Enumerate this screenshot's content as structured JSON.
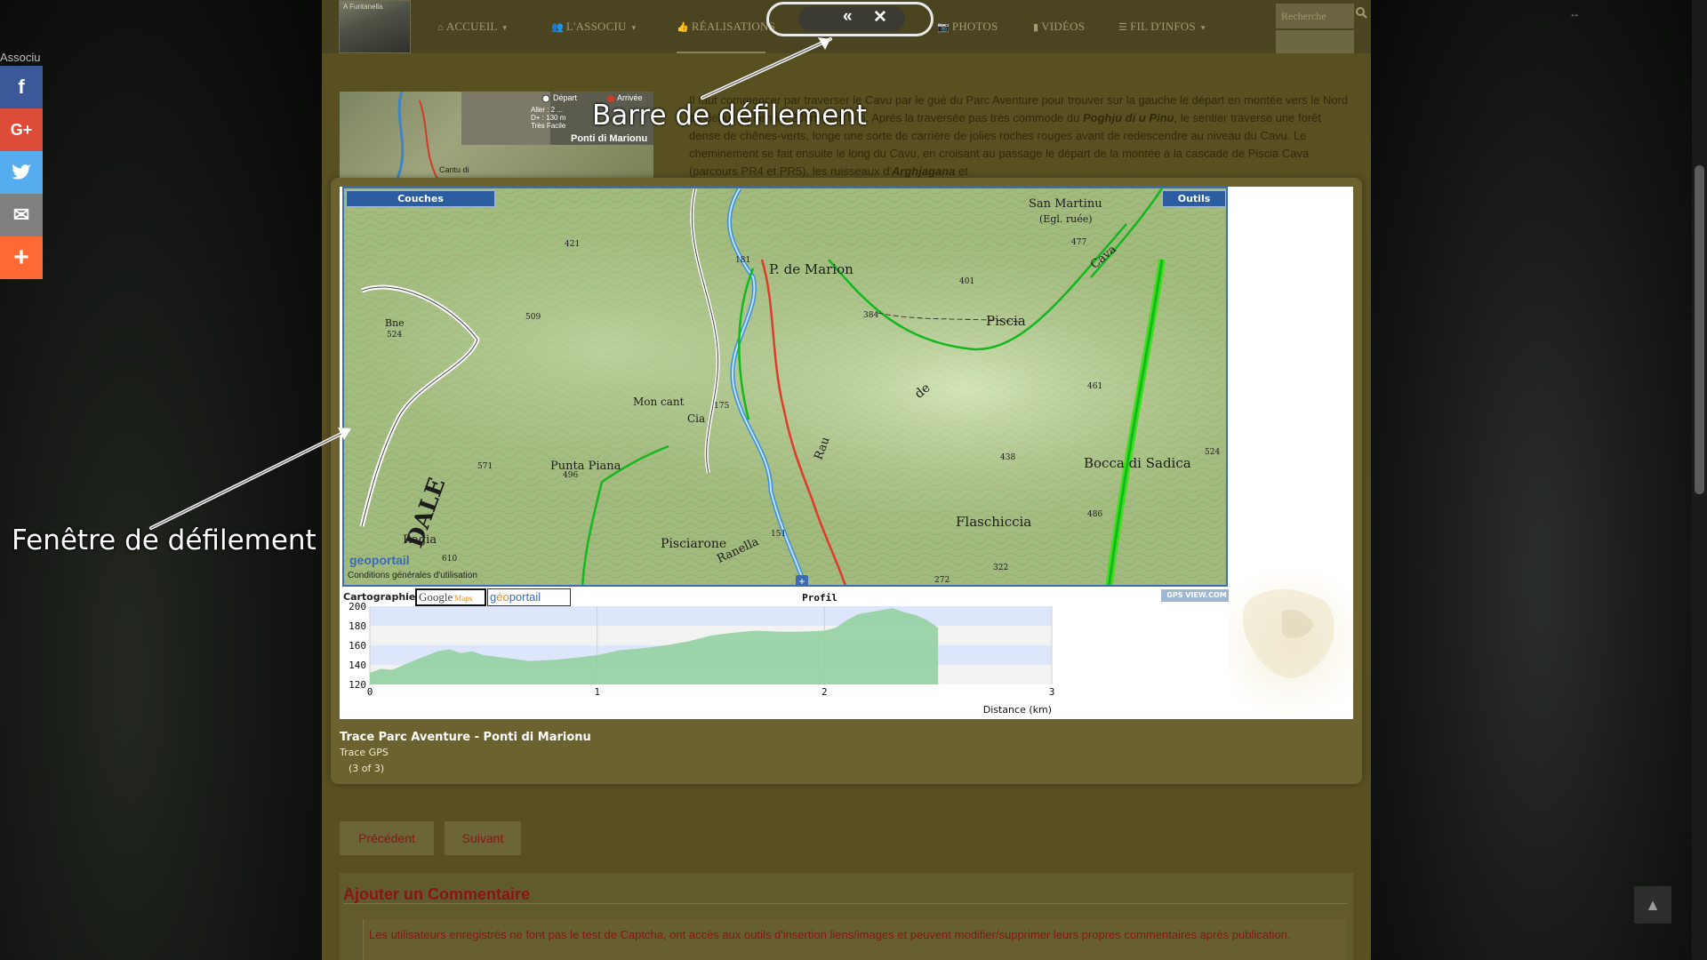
{
  "nav": {
    "items": [
      {
        "label": "ACCUEIL",
        "icon": "home-icon",
        "glyph": "⌂",
        "caret": "▾"
      },
      {
        "label": "L'ASSOCIU",
        "icon": "users-icon",
        "glyph": "👥",
        "caret": "▾"
      },
      {
        "label": "RÉALISATIONS",
        "icon": "thumbs-up-icon",
        "glyph": "👍",
        "caret": ""
      },
      {
        "label": "PHOTOS",
        "icon": "camera-icon",
        "glyph": "📷",
        "caret": ""
      },
      {
        "label": "VIDÉOS",
        "icon": "video-icon",
        "glyph": "▮",
        "caret": ""
      },
      {
        "label": "FIL D'INFOS",
        "icon": "list-icon",
        "glyph": "☰",
        "caret": "▾"
      }
    ],
    "search_placeholder": "Recherche",
    "logo_text": "A Funtanella"
  },
  "article": {
    "text_html_parts": [
      "Il faut commencer par traverser le Cavu par le gué du Parc Aventure pour trouver sur la gauche le départ en montée vers le Nord au début du sentier 200m plus loin. Après la traversée pas très commode du ",
      "Poghju di u Pinu",
      ", le sentier traverse une forêt dense de chênes-verts, longe une sorte de carrière de jolies roches rouges avant de redescendre au niveau du Cavu. Le cheminement se fait ensuite le long du Cavu, en croisant au passage le départ de la montée à la cascade de Piscia Cava (parcours PR4 et PR5), les ruisseaux d'",
      "Arghjagana",
      " et"
    ]
  },
  "thumb": {
    "legend_start": "Départ",
    "legend_end": "Arrivée",
    "stats": "Aller : 2 ...\nD+ : 130 m\nTrès Facile",
    "title": "Ponti di Marionu",
    "label": "Cantu di"
  },
  "lightbox": {
    "layers_label": "Couches",
    "tools_label": "Outils",
    "map_labels": [
      "P. de Marion",
      "San Martinu",
      "(Egl. ruée)",
      "Piscia",
      "Bocca di Sadica",
      "Flaschiccia",
      "Punta Piana",
      "Pisciarone",
      "Ranella",
      "Ragia",
      "Bne",
      "Mon cant",
      "Cia",
      "Cava",
      "de",
      "Rau",
      "DALE"
    ],
    "map_heights": [
      "421",
      "181",
      "509",
      "524",
      "384",
      "401",
      "477",
      "461",
      "438",
      "486",
      "524",
      "322",
      "272",
      "151",
      "571",
      "496",
      "610",
      "175"
    ],
    "map_credit": "Conditions générales d'utilisation",
    "geo_logo": "geoportail",
    "carto_label": "Cartographie:",
    "google_label": "Google",
    "google_maps": "Maps",
    "geo_prefix": "g",
    "geo_o": "éo",
    "geo_suffix": "portail",
    "gps_badge": "GPS VIEW.COM",
    "profile_title": "Profil",
    "caption_title": "Trace Parc Aventure - Ponti di Marionu",
    "caption_sub": "Trace GPS",
    "count": "(3 of 3)",
    "plus": "+"
  },
  "chart_data": {
    "type": "area",
    "title": "Profil",
    "xlabel": "Distance (km)",
    "ylabel": "",
    "xlim": [
      0,
      3
    ],
    "ylim": [
      120,
      200
    ],
    "xticks": [
      0,
      1,
      2,
      3
    ],
    "yticks": [
      120,
      140,
      160,
      180,
      200
    ],
    "series": [
      {
        "x": [
          0,
          0.05,
          0.1,
          0.2,
          0.3,
          0.35,
          0.4,
          0.45,
          0.5,
          0.6,
          0.7,
          0.8,
          0.9,
          1.0,
          1.1,
          1.2,
          1.3,
          1.4,
          1.5,
          1.6,
          1.7,
          1.8,
          1.9,
          2.0,
          2.05,
          2.1,
          2.15,
          2.2,
          2.25,
          2.3,
          2.35,
          2.4,
          2.45,
          2.5
        ],
        "values": [
          132,
          136,
          135,
          145,
          154,
          156,
          152,
          154,
          150,
          147,
          144,
          145,
          147,
          150,
          155,
          157,
          160,
          164,
          170,
          173,
          175,
          174,
          174,
          175,
          178,
          186,
          192,
          194,
          196,
          198,
          194,
          191,
          186,
          178
        ]
      }
    ],
    "colors": {
      "fill": "#8fcf9c",
      "band": "#dde6fb"
    }
  },
  "pager": {
    "prev": "Précédent",
    "next": "Suivant"
  },
  "comments": {
    "title": "Ajouter un Commentaire",
    "notice": "Les utilisateurs enregistrés ne font pas le test de Captcha, ont accès aux outils d'insertion liens/images et peuvent modifier/supprimer leurs propres commentaires après publication."
  },
  "social": {
    "label": "Associu",
    "buttons": [
      {
        "name": "facebook-icon",
        "glyph": "f"
      },
      {
        "name": "google-plus-icon",
        "glyph": "G+"
      },
      {
        "name": "twitter-icon",
        "glyph": "🐦"
      },
      {
        "name": "email-icon",
        "glyph": "✉"
      },
      {
        "name": "more-share-icon",
        "glyph": "+"
      }
    ]
  },
  "annotations": {
    "scrollbar": "Barre de défilement",
    "window": "Fenêtre de défilement",
    "prev_glyph": "«",
    "close_glyph": "✕"
  },
  "misc": {
    "expand_glyph": "↔",
    "top_glyph": "▲"
  }
}
